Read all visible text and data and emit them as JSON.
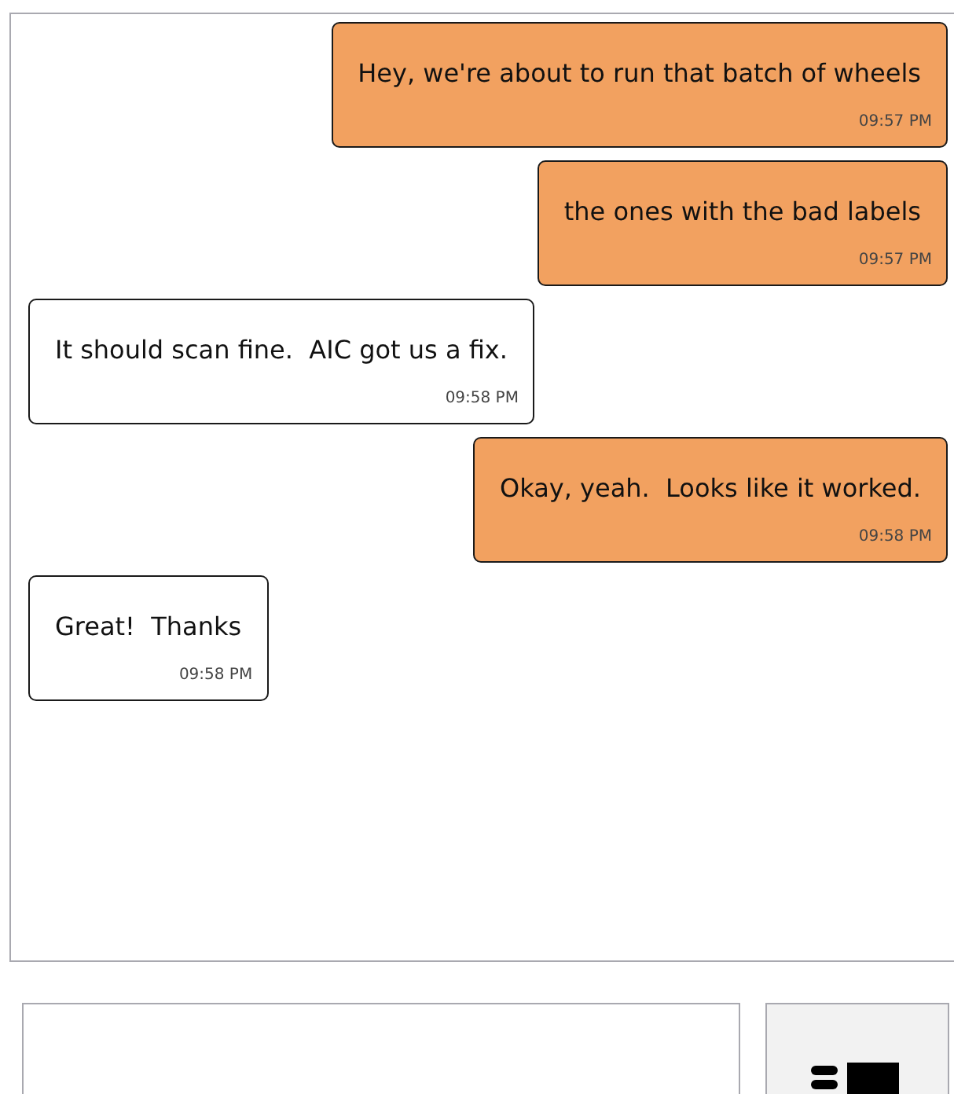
{
  "messages": [
    {
      "kind": "sent",
      "text": "Hey, we're about to run that batch of wheels",
      "time": "09:57 PM"
    },
    {
      "kind": "sent",
      "text": "the ones with the bad labels",
      "time": "09:57 PM"
    },
    {
      "kind": "received",
      "text": "It should scan fine.  AIC got us a fix.",
      "time": "09:58 PM"
    },
    {
      "kind": "sent",
      "text": "Okay, yeah.  Looks like it worked.",
      "time": "09:58 PM"
    },
    {
      "kind": "received",
      "text": "Great!  Thanks",
      "time": "09:58 PM"
    }
  ]
}
